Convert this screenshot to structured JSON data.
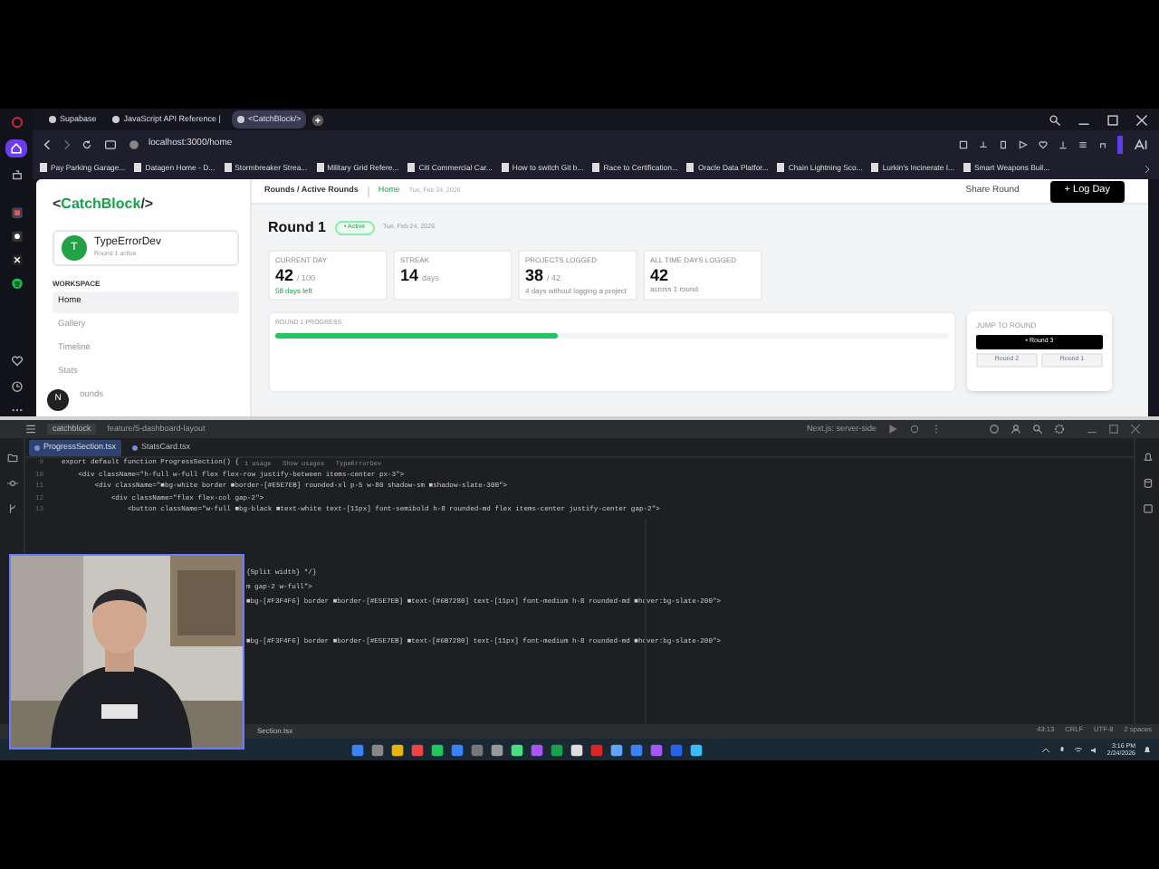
{
  "browser": {
    "tabs": [
      {
        "label": "Supabase",
        "selected": false
      },
      {
        "label": "JavaScript API Reference |",
        "selected": false
      },
      {
        "label": "<CatchBlock/>",
        "selected": true
      }
    ],
    "address": "localhost:3000/home",
    "bookmarks": [
      "Pay Parking Garage...",
      "Datagen Home - D...",
      "Stormbreaker Strea...",
      "Military Grid Refere...",
      "Citi Commercial Car...",
      "How to switch Git b...",
      "Race to Certification...",
      "Oracle Data Platfor...",
      "Chain Lightning Sco...",
      "Lurkin's Incinerate I...",
      "Smart Weapons Buil..."
    ]
  },
  "app": {
    "logo": {
      "open": "<",
      "name": "CatchBlock",
      "close": "/>"
    },
    "user": {
      "initial": "T",
      "name": "TypeErrorDev",
      "subtitle": "Round 1 active"
    },
    "section": "WORKSPACE",
    "nav": [
      {
        "label": "Home",
        "selected": true
      },
      {
        "label": "Gallery",
        "selected": false
      },
      {
        "label": "Timeline",
        "selected": false
      },
      {
        "label": "Stats",
        "selected": false
      },
      {
        "label": "ounds",
        "selected": false
      }
    ],
    "floating_badge": "N",
    "breadcrumb": "Rounds / Active Rounds",
    "crumb_link": "Home",
    "header_date": "Tue, Feb 24, 2026",
    "share_button": "Share Round",
    "log_button": "+ Log Day",
    "title": "Round 1",
    "status_badge": "• Active",
    "title_date": "Tue, Feb 24, 2026",
    "stats": [
      {
        "label": "CURRENT DAY",
        "value": "42",
        "suffix": "/ 100",
        "note": "58 days left",
        "kind": "accent"
      },
      {
        "label": "STREAK",
        "value": "14",
        "suffix": "days"
      },
      {
        "label": "PROJECTS LOGGED",
        "value": "38",
        "suffix": "/ 42",
        "note": "4 days without logging a project",
        "kind": "plain"
      },
      {
        "label": "ALL TIME DAYS LOGGED",
        "value": "42",
        "note": "across 1 round",
        "kind": "plain"
      }
    ],
    "progress": {
      "label": "ROUND 1 PROGRESS",
      "level": 0.42
    },
    "jump": {
      "label": "JUMP TO ROUND",
      "rounds": [
        {
          "label": "• Round 3",
          "selected": true
        },
        {
          "label": "Round 2",
          "selected": false
        },
        {
          "label": "Round 1",
          "selected": false
        }
      ]
    }
  },
  "ide": {
    "project": "catchblock",
    "branch": "feature/5-dashboard-layout",
    "run_config": "Next.js: server-side",
    "tabs": [
      {
        "label": "ProgressSection.tsx",
        "selected": true
      },
      {
        "label": "StatsCard.tsx",
        "selected": false
      }
    ],
    "lines": [
      {
        "line": "9",
        "code": "export default function ProgressSection() {",
        "hint": "1 usage   Show usages   TypeErrorDev"
      },
      {
        "line": "10",
        "code": "    <div className=\"h-full w-full flex flex-row justify-between items-center px-3\">"
      },
      {
        "line": "11",
        "code": "        <div className=\"■bg-white border ■border-[#E5E7EB] rounded-xl p-5 w-80 shadow-sm ■shadow-slate-300\">"
      },
      {
        "line": "12",
        "code": "            <div className=\"flex flex-col gap-2\">"
      },
      {
        "line": "13",
        "code": "                <button className=\"w-full ■bg-black ■text-white text-[11px] font-semibold h-8 rounded-md flex items-center justify-center gap-2\">"
      }
    ],
    "lines_lower": [
      "{Split width} */}",
      "m gap-2 w-full\">",
      "■bg-[#F3F4F6] border ■border-[#E5E7EB] ■text-[#6B7280] text-[11px] font-medium h-8 rounded-md ■hover:bg-slate-200\">",
      "■bg-[#F3F4F6] border ■border-[#E5E7EB] ■text-[#6B7280] text-[11px] font-medium h-8 rounded-md ■hover:bg-slate-200\">"
    ],
    "status_left": "Section.tsx",
    "status_right": [
      "43:13",
      "CRLF",
      "UTF-8",
      "2 spaces"
    ]
  },
  "taskbar": {
    "time": "3:16 PM",
    "date": "2/24/2026"
  }
}
